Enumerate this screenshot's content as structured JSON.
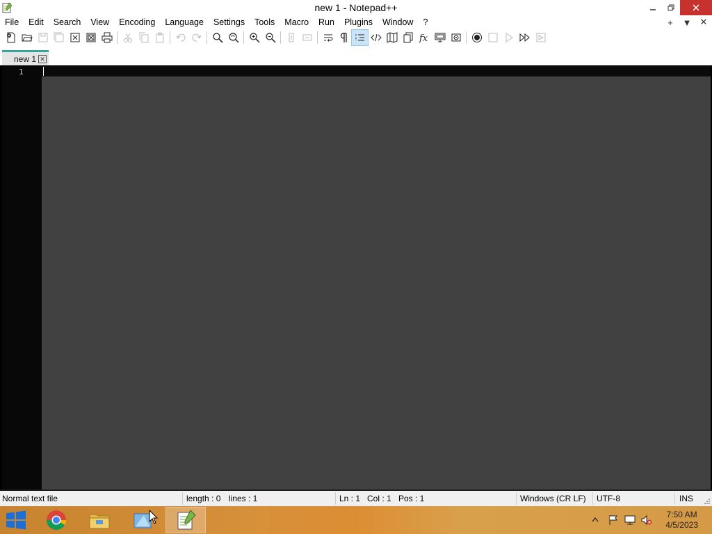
{
  "window": {
    "title": "new 1 - Notepad++"
  },
  "menu": {
    "items": [
      "File",
      "Edit",
      "Search",
      "View",
      "Encoding",
      "Language",
      "Settings",
      "Tools",
      "Macro",
      "Run",
      "Plugins",
      "Window",
      "?"
    ],
    "right": [
      "+",
      "▼",
      "✕"
    ]
  },
  "toolbar": {
    "icons": [
      "new-file-icon",
      "open-file-icon",
      "save-icon",
      "save-all-icon",
      "close-icon",
      "close-all-icon",
      "print-icon",
      "cut-icon",
      "copy-icon",
      "paste-icon",
      "undo-icon",
      "redo-icon",
      "find-icon",
      "replace-icon",
      "zoom-in-icon",
      "zoom-out-icon",
      "sync-vertical-icon",
      "sync-horizontal-icon",
      "word-wrap-icon",
      "show-all-characters-icon",
      "indent-guide-icon",
      "xml-tag-icon",
      "document-map-icon",
      "document-list-icon",
      "function-list-icon",
      "monitoring-icon",
      "folder-as-workspace-icon",
      "record-macro-icon",
      "stop-recording-icon",
      "playback-macro-icon",
      "run-macro-multiple-icon",
      "save-macro-icon"
    ]
  },
  "tabs": [
    {
      "label": "new 1"
    }
  ],
  "editor": {
    "line_numbers": [
      "1"
    ]
  },
  "status": {
    "file_type": "Normal text file",
    "length": "length : 0",
    "lines": "lines : 1",
    "ln": "Ln : 1",
    "col": "Col : 1",
    "pos": "Pos : 1",
    "eol": "Windows (CR LF)",
    "encoding": "UTF-8",
    "mode": "INS"
  },
  "taskbar": {
    "clock_time": "7:50 AM",
    "clock_date": "4/5/2023"
  },
  "colors": {
    "editor_bg": "#414141",
    "tab_accent": "#3aa39a",
    "close_button": "#c7312e"
  }
}
